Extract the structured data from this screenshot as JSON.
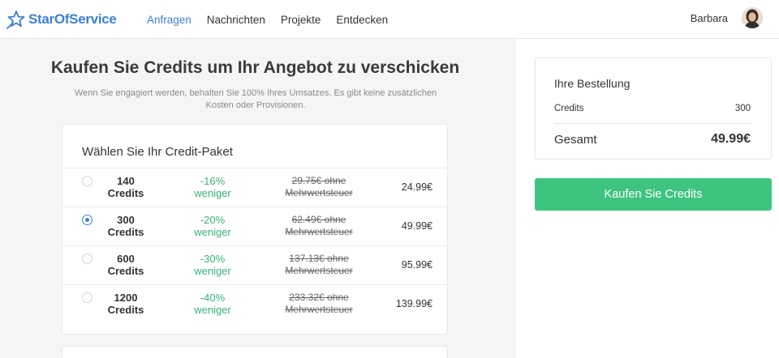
{
  "header": {
    "logo_text": "StarOfService",
    "nav": [
      {
        "label": "Anfragen",
        "active": true
      },
      {
        "label": "Nachrichten",
        "active": false
      },
      {
        "label": "Projekte",
        "active": false
      },
      {
        "label": "Entdecken",
        "active": false
      }
    ],
    "user_name": "Barbara"
  },
  "main": {
    "title": "Kaufen Sie Credits um Ihr Angebot zu verschicken",
    "subtitle": "Wenn Sie engagiert werden, behalten Sie 100% Ihres Umsatzes. Es gibt keine zusätzlichen Kosten oder Provisionen.",
    "card_title": "Wählen Sie Ihr Credit-Paket",
    "packages": [
      {
        "amount": "140",
        "unit": "Credits",
        "discount": "-16%",
        "discount_label": "weniger",
        "old_price": "29.75€ ohne",
        "old_price_suffix": "Mehrwertsteuer",
        "price": "24.99€",
        "selected": false
      },
      {
        "amount": "300",
        "unit": "Credits",
        "discount": "-20%",
        "discount_label": "weniger",
        "old_price": "62.49€ ohne",
        "old_price_suffix": "Mehrwertsteuer",
        "price": "49.99€",
        "selected": true
      },
      {
        "amount": "600",
        "unit": "Credits",
        "discount": "-30%",
        "discount_label": "weniger",
        "old_price": "137.13€ ohne",
        "old_price_suffix": "Mehrwertsteuer",
        "price": "95.99€",
        "selected": false
      },
      {
        "amount": "1200",
        "unit": "Credits",
        "discount": "-40%",
        "discount_label": "weniger",
        "old_price": "233.32€ ohne",
        "old_price_suffix": "Mehrwertsteuer",
        "price": "139.99€",
        "selected": false
      }
    ]
  },
  "order": {
    "title": "Ihre Bestellung",
    "credits_label": "Credits",
    "credits_value": "300",
    "total_label": "Gesamt",
    "total_value": "49.99€"
  },
  "buy_button_label": "Kaufen Sie Credits",
  "colors": {
    "brand_blue": "#3d7fd8",
    "discount_green": "#36b378",
    "button_green": "#3fc47f"
  }
}
